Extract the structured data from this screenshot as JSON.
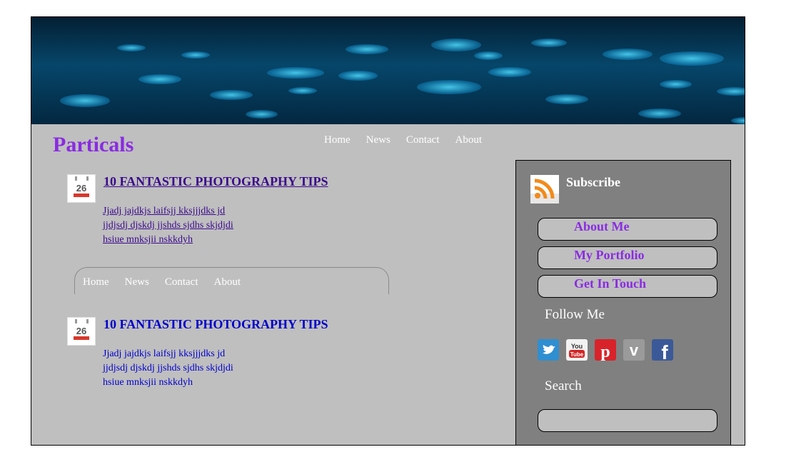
{
  "site": {
    "title": "Particals"
  },
  "top_nav": {
    "items": [
      "Home",
      "News",
      "Contact",
      "About"
    ]
  },
  "posts": [
    {
      "date_day": "26",
      "title": "10 FANTASTIC PHOTOGRAPHY TIPS",
      "lines": [
        "Jjadj jajdkjs laifsjj kksjjjdks jd",
        "jjdjsdj djskdj jjshds sjdhs skjdjdi",
        "hsiue mnksjii nskkdyh"
      ]
    },
    {
      "date_day": "26",
      "title": "10 FANTASTIC PHOTOGRAPHY TIPS",
      "lines": [
        "Jjadj jajdkjs laifsjj kksjjjdks jd",
        "jjdjsdj djskdj jjshds sjdhs skjdjdi",
        "hsiue mnksjii nskkdyh"
      ]
    }
  ],
  "mid_nav": {
    "items": [
      "Home",
      "News",
      "Contact",
      "About"
    ]
  },
  "sidebar": {
    "subscribe_label": "Subscribe",
    "buttons": [
      "About Me",
      "My Portfolio",
      "Get In Touch"
    ],
    "follow_label": "Follow Me",
    "social_icons": [
      "twitter-icon",
      "youtube-icon",
      "pinterest-icon",
      "vimeo-icon",
      "facebook-icon"
    ],
    "search_label": "Search",
    "search_value": ""
  },
  "colors": {
    "accent": "#8a2be2",
    "background": "#bfbfbf",
    "sidebar": "#808080",
    "link_visited": "#3b0a8c",
    "link": "#0000cc"
  }
}
